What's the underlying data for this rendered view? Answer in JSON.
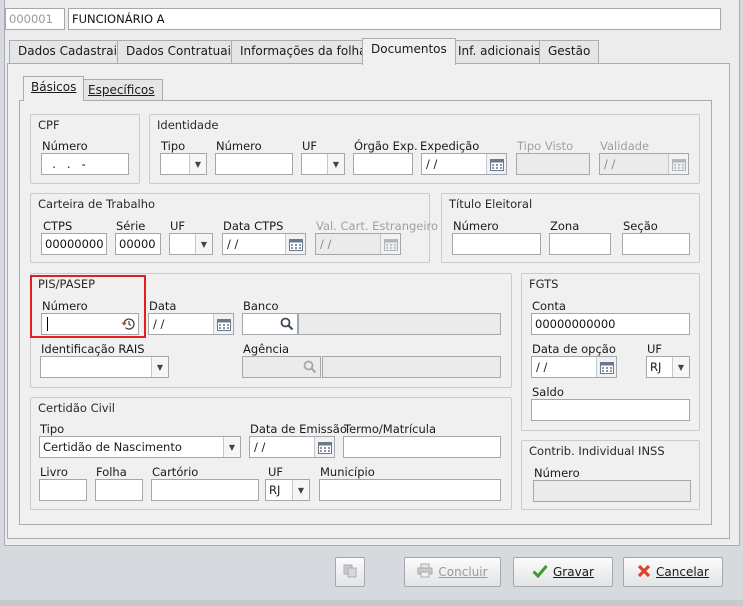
{
  "header": {
    "code": "000001",
    "name": "FUNCIONÁRIO A"
  },
  "tabs": [
    {
      "label": "Dados Cadastrais"
    },
    {
      "label": "Dados Contratuais"
    },
    {
      "label": "Informações da folha"
    },
    {
      "label": "Documentos"
    },
    {
      "label": "Inf. adicionais"
    },
    {
      "label": "Gestão"
    }
  ],
  "subtabs": [
    {
      "label": "Básicos"
    },
    {
      "label": "Específicos"
    }
  ],
  "cpf": {
    "title": "CPF",
    "numero_label": "Número",
    "numero": "  .   .   -"
  },
  "identidade": {
    "title": "Identidade",
    "tipo_label": "Tipo",
    "numero_label": "Número",
    "uf_label": "UF",
    "orgao_label": "Órgão Exp.",
    "expedicao_label": "Expedição",
    "expedicao": "/ /",
    "tipo_visto_label": "Tipo Visto",
    "validade_label": "Validade",
    "validade": "/ /"
  },
  "ctps": {
    "title": "Carteira de Trabalho",
    "ctps_label": "CTPS",
    "ctps": "00000000",
    "serie_label": "Série",
    "serie": "00000",
    "uf_label": "UF",
    "data_label": "Data CTPS",
    "data": "/ /",
    "val_label": "Val. Cart. Estrangeiro",
    "val": "/ /"
  },
  "titulo": {
    "title": "Título Eleitoral",
    "numero_label": "Número",
    "zona_label": "Zona",
    "secao_label": "Seção"
  },
  "pis": {
    "title": "PIS/PASEP",
    "numero_label": "Número",
    "data_label": "Data",
    "data": "/ /",
    "banco_label": "Banco",
    "rais_label": "Identificação RAIS",
    "agencia_label": "Agência"
  },
  "fgts": {
    "title": "FGTS",
    "conta_label": "Conta",
    "conta": "00000000000",
    "data_label": "Data de opção",
    "data": "/ /",
    "uf_label": "UF",
    "uf": "RJ",
    "saldo_label": "Saldo"
  },
  "certidao": {
    "title": "Certidão Civil",
    "tipo_label": "Tipo",
    "tipo": "Certidão de Nascimento",
    "emissao_label": "Data de Emissão",
    "emissao": "/ /",
    "termo_label": "Termo/Matrícula",
    "livro_label": "Livro",
    "folha_label": "Folha",
    "cartorio_label": "Cartório",
    "uf_label": "UF",
    "uf": "RJ",
    "municipio_label": "Município"
  },
  "inss": {
    "title": "Contrib. Individual INSS",
    "numero_label": "Número"
  },
  "buttons": {
    "concluir": "Concluir",
    "gravar": "Gravar",
    "cancelar": "Cancelar"
  },
  "colors": {
    "highlight": "#e02020",
    "gravar_check": "#3f9b2f",
    "cancelar_x": "#d9472b"
  }
}
